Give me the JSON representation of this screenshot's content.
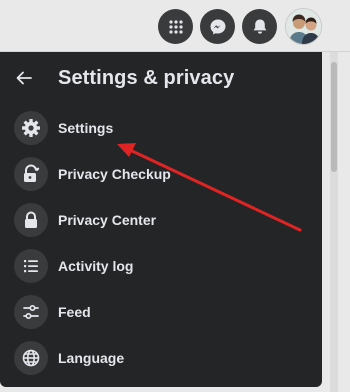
{
  "header": {
    "title": "Settings & privacy",
    "back_icon": "arrow-left-icon"
  },
  "topbar": {
    "icons": [
      "menu-grid-icon",
      "messenger-icon",
      "bell-icon"
    ],
    "button_color": "#3a3b3c"
  },
  "menu": {
    "items": [
      {
        "label": "Settings",
        "icon": "gear-icon"
      },
      {
        "label": "Privacy Checkup",
        "icon": "lock-heart-icon"
      },
      {
        "label": "Privacy Center",
        "icon": "lock-icon"
      },
      {
        "label": "Activity log",
        "icon": "list-icon"
      },
      {
        "label": "Feed",
        "icon": "sliders-icon"
      },
      {
        "label": "Language",
        "icon": "globe-icon"
      }
    ]
  },
  "colors": {
    "panel": "#242526",
    "text": "#e4e6eb",
    "icon_bg": "#3a3b3c",
    "annotation_arrow": "#e02424"
  }
}
